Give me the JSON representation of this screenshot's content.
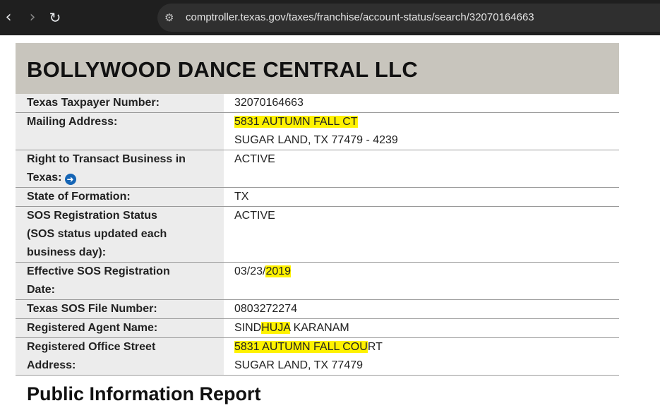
{
  "browser": {
    "back_icon": "‹",
    "forward_icon": "›",
    "reload_icon": "↻",
    "site_info_icon": "⚙",
    "url": "comptroller.texas.gov/taxes/franchise/account-status/search/32070164663"
  },
  "entity": {
    "name": "BOLLYWOOD DANCE CENTRAL LLC"
  },
  "rows": {
    "taxpayer_number": {
      "label": "Texas Taxpayer Number:",
      "value": "32070164663"
    },
    "mailing_address": {
      "label": "Mailing Address:",
      "line1": "5831 AUTUMN FALL CT",
      "line2": "SUGAR LAND, TX 77479 - 4239"
    },
    "right_to_transact": {
      "label_line1": "Right to Transact Business in",
      "label_line2": "Texas:",
      "value": "ACTIVE"
    },
    "state_of_formation": {
      "label": "State of Formation:",
      "value": "TX"
    },
    "sos_status": {
      "label_line1": "SOS Registration Status",
      "label_line2": "(SOS status updated each",
      "label_line3": "business day):",
      "value": "ACTIVE"
    },
    "effective_sos_date": {
      "label_line1": "Effective SOS Registration",
      "label_line2": "Date:",
      "value_prefix": "03/23/",
      "value_highlight": "2019"
    },
    "sos_file_number": {
      "label": "Texas SOS File Number:",
      "value": "0803272274"
    },
    "registered_agent": {
      "label": "Registered Agent Name:",
      "value_part1": "SIND",
      "value_highlight": "HUJA",
      "value_part2": " KARANAM"
    },
    "registered_office": {
      "label_line1": "Registered Office Street",
      "label_line2": "Address:",
      "line1_highlight": "5831 AUTUMN FALL COU",
      "line1_rest": "RT",
      "line2": "SUGAR LAND, TX 77479"
    }
  },
  "section": {
    "public_information_report": "Public Information Report"
  },
  "colors": {
    "title_band": "#c8c5bd",
    "label_cell": "#ececec",
    "highlight": "#fff200",
    "info_arrow": "#1565b5"
  }
}
